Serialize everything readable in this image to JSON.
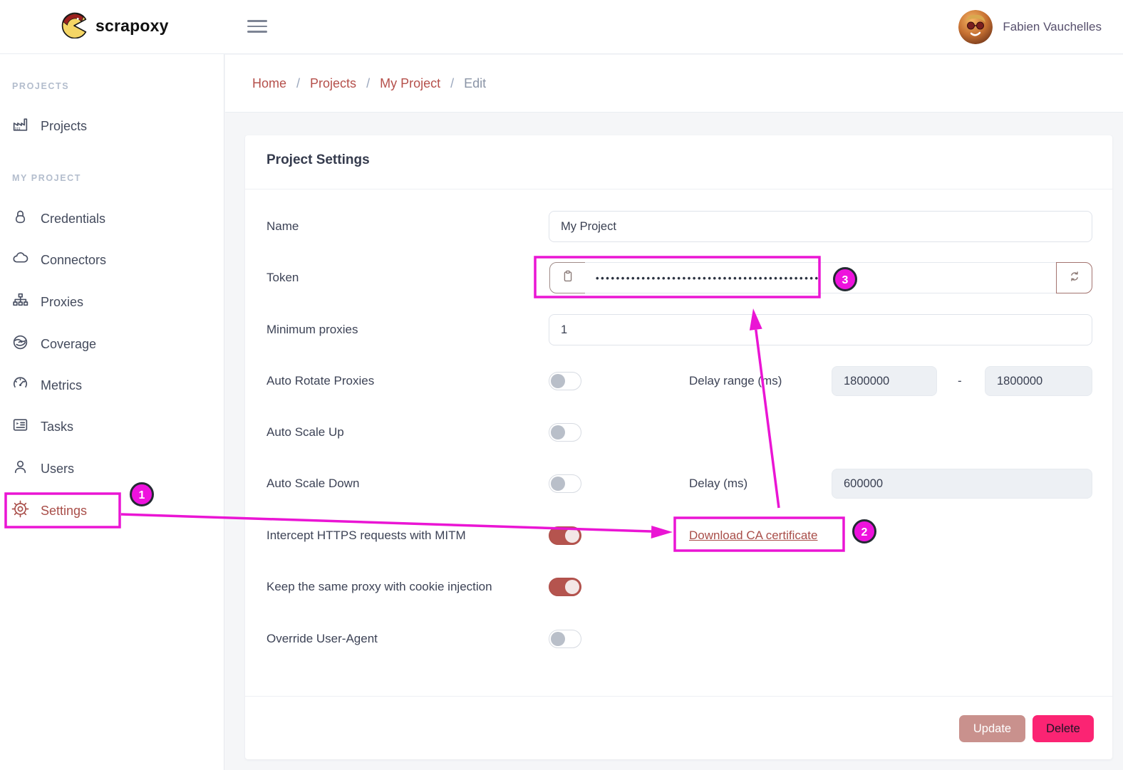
{
  "brand": {
    "name": "scrapoxy"
  },
  "topbar": {
    "user_name": "Fabien Vauchelles"
  },
  "breadcrumb": {
    "separator": "/",
    "links": [
      "Home",
      "Projects",
      "My Project"
    ],
    "current": "Edit"
  },
  "sidebar": {
    "sections": [
      {
        "label": "PROJECTS",
        "items": [
          {
            "label": "Projects",
            "icon": "factory-icon"
          }
        ]
      },
      {
        "label": "MY PROJECT",
        "items": [
          {
            "label": "Credentials",
            "icon": "lock-icon"
          },
          {
            "label": "Connectors",
            "icon": "cloud-icon"
          },
          {
            "label": "Proxies",
            "icon": "sitemap-icon"
          },
          {
            "label": "Coverage",
            "icon": "globe-icon"
          },
          {
            "label": "Metrics",
            "icon": "gauge-icon"
          },
          {
            "label": "Tasks",
            "icon": "task-list-icon"
          },
          {
            "label": "Users",
            "icon": "person-icon"
          },
          {
            "label": "Settings",
            "icon": "gear-icon",
            "active": true
          }
        ]
      }
    ]
  },
  "form": {
    "title": "Project Settings",
    "rows": {
      "name": {
        "label": "Name",
        "value": "My Project"
      },
      "token": {
        "label": "Token",
        "masked_value": "••••••••••••••••••••••••••••••••••••••••••••"
      },
      "min_proxies": {
        "label": "Minimum proxies",
        "value": "1"
      },
      "auto_rotate": {
        "label": "Auto Rotate Proxies",
        "state": "off",
        "delay_label": "Delay range (ms)",
        "delay_min": "1800000",
        "range_separator": "-",
        "delay_max": "1800000"
      },
      "auto_scale_up": {
        "label": "Auto Scale Up",
        "state": "off"
      },
      "auto_scale_down": {
        "label": "Auto Scale Down",
        "state": "off",
        "delay_label": "Delay (ms)",
        "delay": "600000"
      },
      "mitm": {
        "label": "Intercept HTTPS requests with MITM",
        "state": "on",
        "link_label": "Download CA certificate"
      },
      "cookie": {
        "label": "Keep the same proxy with cookie injection",
        "state": "on"
      },
      "user_agent": {
        "label": "Override User-Agent",
        "state": "off"
      }
    },
    "footer": {
      "update_label": "Update",
      "delete_label": "Delete"
    }
  },
  "annotations": {
    "badge1": "1",
    "badge2": "2",
    "badge3": "3"
  },
  "colors": {
    "accent_maroon": "#a94e49",
    "toggle_on": "#b5544e",
    "annotation_magenta": "#ea15d4",
    "badge_fill": "#ee12dd",
    "update_button": "#c9918d",
    "delete_button": "#fb2473",
    "breadcrumb_link": "#b5504b",
    "content_background": "#f5f6f8"
  }
}
